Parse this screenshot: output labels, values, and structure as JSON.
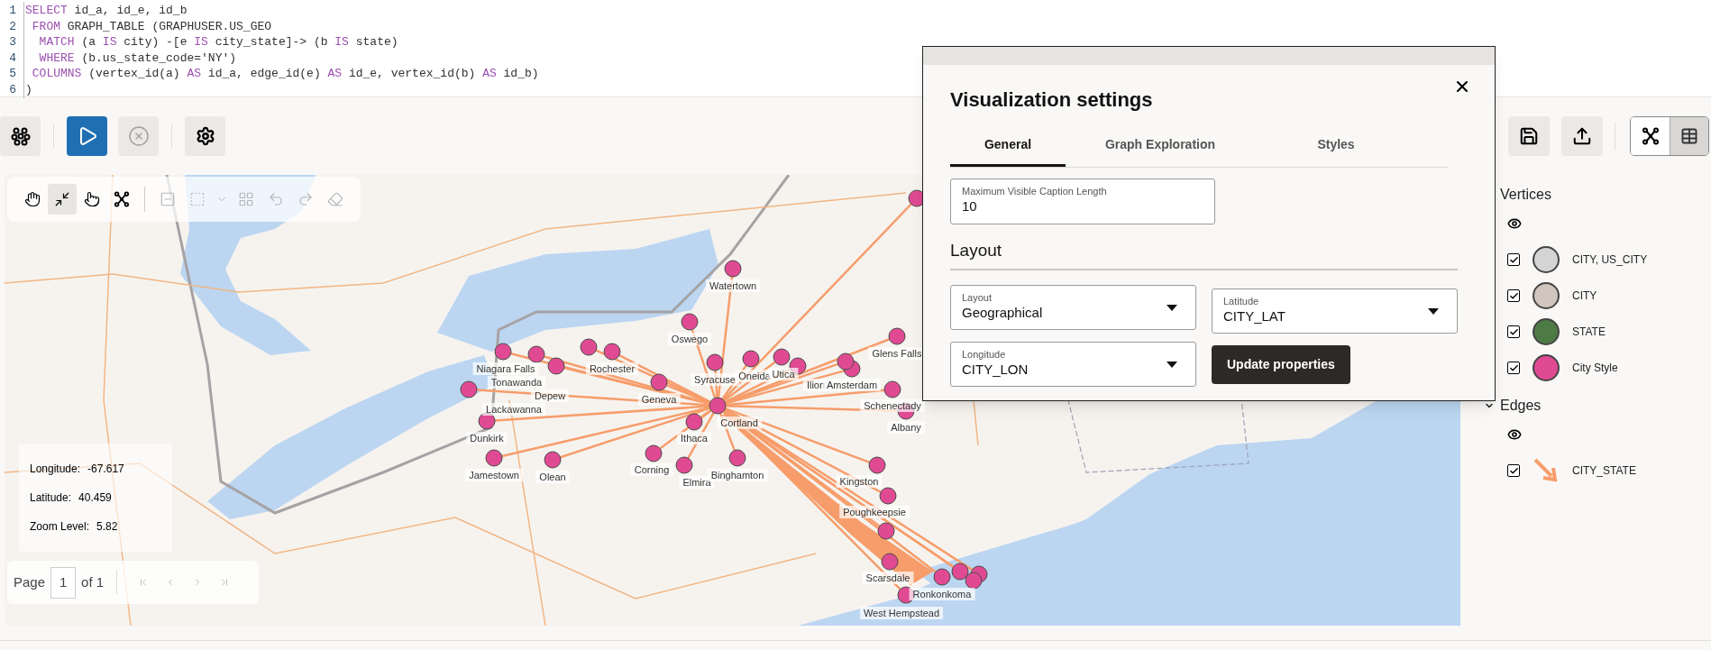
{
  "editor": {
    "lines": [
      {
        "number": "1",
        "tokens": [
          {
            "text": "SELECT",
            "kind": "keyword"
          },
          {
            "text": " id_a, id_e, id_b",
            "kind": "plain"
          }
        ]
      },
      {
        "number": "2",
        "tokens": [
          {
            "text": " FROM",
            "kind": "keyword"
          },
          {
            "text": " GRAPH_TABLE (GRAPHUSER.US_GEO",
            "kind": "plain"
          }
        ]
      },
      {
        "number": "3",
        "tokens": [
          {
            "text": "  MATCH",
            "kind": "keyword"
          },
          {
            "text": " (a ",
            "kind": "plain"
          },
          {
            "text": "IS",
            "kind": "keyword"
          },
          {
            "text": " city) -[e ",
            "kind": "plain"
          },
          {
            "text": "IS",
            "kind": "keyword"
          },
          {
            "text": " city_state]-> (b ",
            "kind": "plain"
          },
          {
            "text": "IS",
            "kind": "keyword"
          },
          {
            "text": " state)",
            "kind": "plain"
          }
        ]
      },
      {
        "number": "4",
        "tokens": [
          {
            "text": "  WHERE",
            "kind": "keyword"
          },
          {
            "text": " (b.us_state_code='NY')",
            "kind": "plain"
          }
        ]
      },
      {
        "number": "5",
        "tokens": [
          {
            "text": " COLUMNS",
            "kind": "keyword"
          },
          {
            "text": " (vertex_id(a) ",
            "kind": "plain"
          },
          {
            "text": "AS",
            "kind": "keyword"
          },
          {
            "text": " id_a, edge_id(e) ",
            "kind": "plain"
          },
          {
            "text": "AS",
            "kind": "keyword"
          },
          {
            "text": " id_e, vertex_id(b) ",
            "kind": "plain"
          },
          {
            "text": "AS",
            "kind": "keyword"
          },
          {
            "text": " id_b)",
            "kind": "plain"
          }
        ]
      },
      {
        "number": "6",
        "tokens": [
          {
            "text": ")",
            "kind": "plain"
          }
        ]
      }
    ]
  },
  "toolbar": {
    "left_buttons": [
      {
        "kind": "graph-query",
        "disabled": false
      },
      {
        "kind": "run",
        "disabled": false
      },
      {
        "kind": "cancel",
        "disabled": true
      },
      {
        "kind": "settings",
        "disabled": false
      }
    ],
    "right_buttons": [
      {
        "kind": "save",
        "disabled": false
      },
      {
        "kind": "export",
        "disabled": false
      }
    ],
    "view_toggle": [
      {
        "kind": "graph",
        "selected": true
      },
      {
        "kind": "table",
        "selected": false
      }
    ]
  },
  "map": {
    "tools": [
      {
        "kind": "pan",
        "selected": false,
        "disabled": false
      },
      {
        "kind": "fit",
        "selected": true,
        "disabled": false
      },
      {
        "kind": "select",
        "selected": false,
        "disabled": false
      },
      {
        "kind": "graph",
        "selected": false,
        "disabled": false
      },
      {
        "kind": "remove",
        "selected": false,
        "disabled": true
      },
      {
        "kind": "group",
        "selected": false,
        "disabled": true
      },
      {
        "kind": "menu",
        "selected": false,
        "disabled": true
      },
      {
        "kind": "layout",
        "selected": false,
        "disabled": true
      },
      {
        "kind": "undo",
        "selected": false,
        "disabled": true
      },
      {
        "kind": "redo",
        "selected": false,
        "disabled": true
      },
      {
        "kind": "clear",
        "selected": false,
        "disabled": true
      }
    ],
    "info": [
      {
        "label": "Longitude:",
        "value": "-67.617"
      },
      {
        "label": "Latitude:",
        "value": "40.459"
      },
      {
        "label": "Zoom Level:",
        "value": "5.82"
      }
    ],
    "pagination": {
      "label": "Page",
      "value": "1",
      "total": "of 1",
      "nav": [
        {
          "kind": "first",
          "disabled": true
        },
        {
          "kind": "previous",
          "disabled": true
        },
        {
          "kind": "next",
          "disabled": true
        },
        {
          "kind": "last",
          "disabled": true
        }
      ]
    },
    "vertices": [
      {
        "kind": "labeled",
        "label": "Watertown"
      },
      {
        "kind": "labeled",
        "label": "Oswego"
      },
      {
        "kind": "labeled",
        "label": "Syracuse"
      },
      {
        "kind": "labeled",
        "label": "Oneida"
      },
      {
        "kind": "labeled",
        "label": "Utica"
      },
      {
        "kind": "labeled",
        "label": "Ilion"
      },
      {
        "kind": "labeled",
        "label": "Glens Falls"
      },
      {
        "kind": "labeled",
        "label": "Amsterdam"
      },
      {
        "kind": "labeled",
        "label": "Schenectady"
      },
      {
        "kind": "labeled",
        "label": "Albany"
      },
      {
        "kind": "labeled",
        "label": "Geneva"
      },
      {
        "kind": "labeled",
        "label": "Rochester"
      },
      {
        "kind": "plain"
      },
      {
        "kind": "labeled",
        "label": "Niagara Falls"
      },
      {
        "kind": "labeled",
        "label": "Tonawanda"
      },
      {
        "kind": "labeled",
        "label": "Depew"
      },
      {
        "kind": "labeled",
        "label": "Lackawanna"
      },
      {
        "kind": "labeled",
        "label": "Dunkirk"
      },
      {
        "kind": "labeled",
        "label": "Jamestown"
      },
      {
        "kind": "labeled",
        "label": "Olean"
      },
      {
        "kind": "labeled",
        "label": "Corning"
      },
      {
        "kind": "labeled",
        "label": "Ithaca"
      },
      {
        "kind": "labeled",
        "label": "Elmira"
      },
      {
        "kind": "labeled",
        "label": "Cortland"
      },
      {
        "kind": "labeled",
        "label": "Binghamton"
      },
      {
        "kind": "plain"
      },
      {
        "kind": "labeled",
        "label": "Kingston"
      },
      {
        "kind": "labeled",
        "label": "Poughkeepsie"
      },
      {
        "kind": "labeled",
        "label": "Scarsdale"
      },
      {
        "kind": "labeled",
        "label": "Ronkonkoma"
      },
      {
        "kind": "labeled",
        "label": "West Hempstead"
      },
      {
        "kind": "plain"
      },
      {
        "kind": "plain"
      },
      {
        "kind": "plain"
      },
      {
        "kind": "plain"
      },
      {
        "kind": "plain"
      }
    ]
  },
  "dialog": {
    "title": "Visualization settings",
    "tabs": [
      {
        "label": "General",
        "selected": true
      },
      {
        "label": "Graph Exploration",
        "selected": false
      },
      {
        "label": "Styles",
        "selected": false
      }
    ],
    "caption_field": {
      "label": "Maximum Visible Caption Length",
      "value": "10"
    },
    "section": "Layout",
    "selects": [
      {
        "label": "Layout",
        "value": "Geographical"
      },
      {
        "label": "Latitude",
        "value": "CITY_LAT"
      },
      {
        "label": "Longitude",
        "value": "CITY_LON"
      }
    ],
    "button": "Update properties"
  },
  "legend": {
    "sections": [
      {
        "title": "Vertices",
        "expanded": true,
        "items": [
          {
            "label": "CITY, US_CITY",
            "kind": "circle",
            "color": "#d4d4d4",
            "checked": true
          },
          {
            "label": "CITY",
            "kind": "circle",
            "color": "#d1c5bd",
            "checked": true
          },
          {
            "label": "STATE",
            "kind": "circle",
            "color": "#4e7a45",
            "checked": true
          },
          {
            "label": "City Style",
            "kind": "circle",
            "color": "#e04a93",
            "checked": true
          }
        ]
      },
      {
        "title": "Edges",
        "expanded": true,
        "items": [
          {
            "label": "CITY_STATE",
            "kind": "arrow",
            "color": "#f79d6b",
            "checked": true
          }
        ]
      }
    ]
  }
}
